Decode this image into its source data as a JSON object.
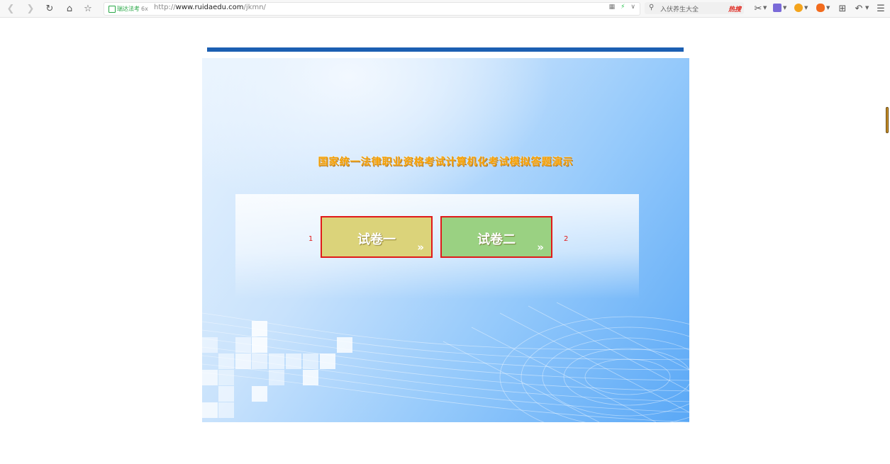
{
  "browser": {
    "site_badge": "瑞达法考",
    "site_badge_extra": "6x",
    "url_prefix": "http://",
    "url_host": "www.ruidaedu.com",
    "url_path": "/jkmn/",
    "search_placeholder": "入伏养生大全",
    "search_hot_label": "热搜",
    "icons": [
      "back-icon",
      "forward-icon",
      "reload-icon",
      "home-icon",
      "star-icon",
      "grid-icon",
      "bolt-icon",
      "chevron-down-icon",
      "search-icon",
      "scissors-icon",
      "translate-icon",
      "shield-icon",
      "gamepad-icon",
      "apps-icon",
      "undo-icon",
      "menu-icon"
    ]
  },
  "page": {
    "title": "国家统一法律职业资格考试计算机化考试模拟答题演示",
    "buttons": [
      {
        "number": "1",
        "label": "试卷一",
        "chevron": "»",
        "color": "#dbd37a"
      },
      {
        "number": "2",
        "label": "试卷二",
        "chevron": "»",
        "color": "#9ad182"
      }
    ]
  },
  "colors": {
    "top_bar": "#1c5fb2",
    "title": "#f6a000",
    "button_border": "#e01a1a",
    "number": "#e01a1a"
  }
}
